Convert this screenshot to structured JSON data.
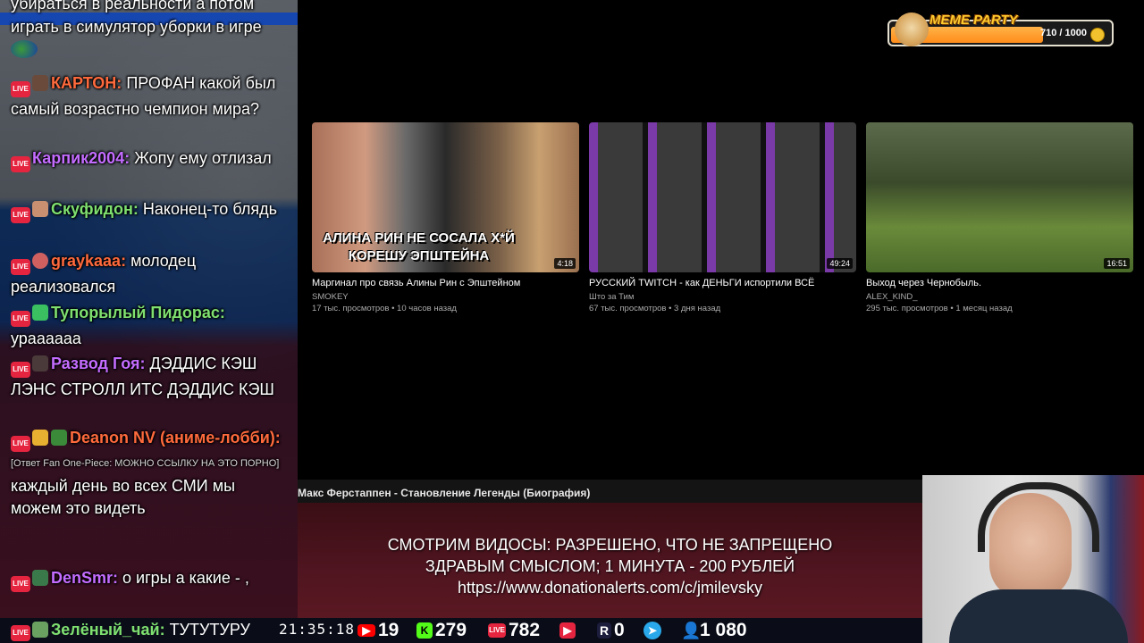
{
  "chat": {
    "messages": [
      {
        "text": "убираться в реальности а потом играть в симулятор уборки в игре"
      },
      {
        "nick": "КАРТОН:",
        "text": "ПРОФАН какой был самый возрастно чемпион мира?",
        "color": "#ff6a3d",
        "bold_word": "ПРОФАН"
      },
      {
        "nick": "Карпик2004:",
        "text": "Жопу ему отлизал",
        "color": "#c46cff"
      },
      {
        "nick": "Скуфидон:",
        "text": "Наконец-то блядь",
        "color": "#7fe070"
      },
      {
        "nick": "graykaaa:",
        "text": "молодец реализовался",
        "color": "#ff6a3d"
      },
      {
        "nick": "Тупорылый Пидорас:",
        "text": "ураааааа",
        "color": "#7fe070"
      },
      {
        "nick": "Развод Гоя:",
        "text": "ДЭДДИС КЭШ ЛЭНС СТРОЛЛ ИТС ДЭДДИС КЭШ",
        "color": "#c46cff"
      },
      {
        "nick": "Deanon NV (аниме-лобби):",
        "color": "#ff6a3d",
        "reply": "[Ответ Fan One-Piece: МОЖНО ССЫЛКУ НА ЭТО ПОРНО]",
        "text": "каждый день во всех СМИ мы можем это видеть"
      },
      {
        "nick": "DenSmr:",
        "text": "о игры а какие - ,",
        "color": "#c46cff"
      },
      {
        "nick": "Зелёный_чай:",
        "text": "ТУТУТУРУ",
        "color": "#7fe070"
      }
    ],
    "live_label": "LIVE"
  },
  "stats": {
    "clock": "21:35:18",
    "youtube": "19",
    "kick": "279",
    "vk": "782",
    "rutube": "0",
    "telegram": "",
    "total": "1 080"
  },
  "videos": [
    {
      "title": "Маргинал про связь Алины Рин с Эпштейном",
      "channel": "SMOKEY",
      "meta": "17 тыс. просмотров • 10 часов назад",
      "duration": "4:18",
      "overlay": "АЛИНА РИН НЕ СОСАЛА Х*Й КОРЕШУ ЭПШТЕЙНА"
    },
    {
      "title": "РУССКИЙ TWITCH - как ДЕНЬГИ испортили ВСЁ",
      "channel": "Што за Тим",
      "meta": "67 тыс. просмотров • 3 дня назад",
      "duration": "49:24"
    },
    {
      "title": "Выход через Чернобыль.",
      "channel": "ALEX_KIND_",
      "meta": "295 тыс. просмотров • 1 месяц назад",
      "duration": "16:51"
    }
  ],
  "meme_party": {
    "label": "MEME PARTY",
    "progress_text": "710 / 1000",
    "progress": 0.71
  },
  "now_playing": "Макс Ферстаппен - Становление Легенды (Биография)",
  "rules": {
    "line1": "СМОТРИМ ВИДОСЫ: РАЗРЕШЕНО, ЧТО НЕ ЗАПРЕЩЕНО",
    "line2": "ЗДРАВЫМ СМЫСЛОМ; 1 МИНУТА - 200 РУБЛЕЙ",
    "line3": "https://www.donationalerts.com/c/jmilevsky"
  },
  "colors": {
    "youtube": "#ff0000",
    "kick": "#53fc18",
    "vk": "#e5253f",
    "rutube": "#1c1c3c",
    "telegram": "#29a9eb",
    "viewers": "#5aa0ff"
  }
}
